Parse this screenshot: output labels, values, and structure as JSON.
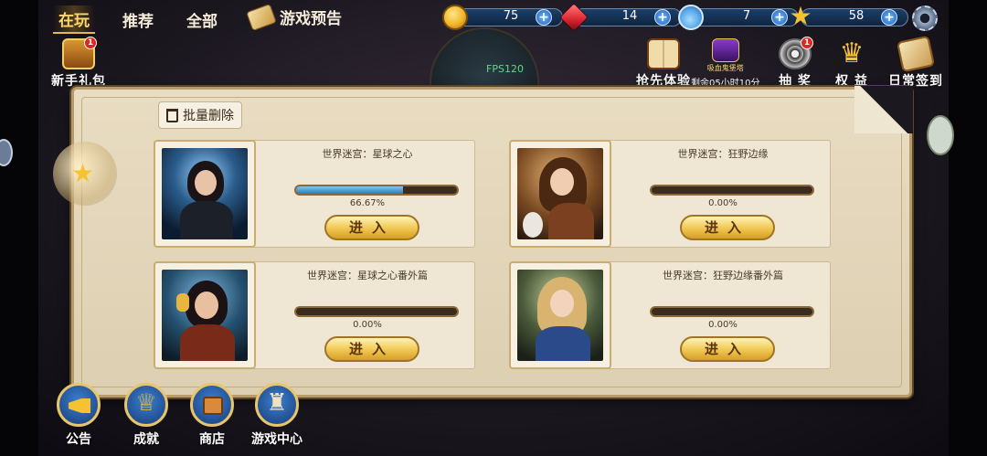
{
  "tabs": [
    {
      "label": "在玩",
      "active": true
    },
    {
      "label": "推荐",
      "active": false
    },
    {
      "label": "全部",
      "active": false
    }
  ],
  "notice": {
    "label": "游戏预告",
    "icon": "scroll-icon"
  },
  "resources": [
    {
      "name": "coin",
      "icon": "coin-icon",
      "value": "75",
      "color": "#f2b52a"
    },
    {
      "name": "ruby",
      "icon": "ruby-icon",
      "value": "14",
      "color": "#d8232e"
    },
    {
      "name": "potion",
      "icon": "potion-icon",
      "value": "7",
      "color": "#57a6e8"
    },
    {
      "name": "star",
      "icon": "star-icon",
      "value": "58",
      "color": "#f5c232"
    }
  ],
  "fps": "FPS120",
  "newbie_gift": {
    "label": "新手礼包",
    "badge": "1"
  },
  "top_actions": [
    {
      "label": "抢先体验",
      "icon": "book-icon"
    },
    {
      "label": "剩余05小时10分",
      "icon": "vampire-castle-icon",
      "sub": "吸血鬼堡塔"
    },
    {
      "label": "抽  奖",
      "icon": "film-reel-icon",
      "badge": "1"
    },
    {
      "label": "权  益",
      "icon": "crown-icon"
    },
    {
      "label": "日常签到",
      "icon": "scroll-quill-icon"
    }
  ],
  "batch_delete": {
    "label": "批量删除"
  },
  "games": [
    {
      "title": "世界迷宫：星球之心",
      "progress": 0.6667,
      "progress_text": "66.67%",
      "button": "进入",
      "portrait": "dark-hair-warrior-woman"
    },
    {
      "title": "世界迷宫：狂野边缘",
      "progress": 0.0,
      "progress_text": "0.00%",
      "button": "进入",
      "portrait": "steampunk-girl-with-rabbit"
    },
    {
      "title": "世界迷宫：星球之心番外篇",
      "progress": 0.0,
      "progress_text": "0.00%",
      "button": "进入",
      "portrait": "girl-with-headphones"
    },
    {
      "title": "世界迷宫：狂野边缘番外篇",
      "progress": 0.0,
      "progress_text": "0.00%",
      "button": "进入",
      "portrait": "blonde-girl-blue-dress"
    }
  ],
  "bottom_nav": [
    {
      "label": "公告",
      "icon": "megaphone-icon"
    },
    {
      "label": "成就",
      "icon": "trophy-icon"
    },
    {
      "label": "商店",
      "icon": "shop-register-icon"
    },
    {
      "label": "游戏中心",
      "icon": "chess-icon"
    }
  ],
  "colors": {
    "accent_gold": "#e2b84f",
    "progress_blue": "#2a7fb8",
    "fps_green": "#64d884"
  }
}
